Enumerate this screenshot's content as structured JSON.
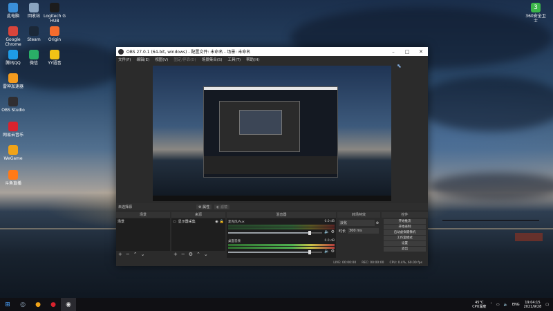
{
  "desktop": {
    "icons": [
      {
        "label": "此电脑",
        "icon": "computer-icon",
        "color": "#3a8fd9"
      },
      {
        "label": "回收站",
        "icon": "recycle-bin-icon",
        "color": "#8aa4c0"
      },
      {
        "label": "Logitech G HUB",
        "icon": "logitech-icon",
        "color": "#1c1c1c"
      },
      {
        "label": "Google Chrome",
        "icon": "chrome-icon",
        "color": "#d9453b"
      },
      {
        "label": "Steam",
        "icon": "steam-icon",
        "color": "#1b2838"
      },
      {
        "label": "Origin",
        "icon": "origin-icon",
        "color": "#f56c2d"
      },
      {
        "label": "腾讯QQ",
        "icon": "qq-icon",
        "color": "#1e9be6"
      },
      {
        "label": "微信",
        "icon": "wechat-icon",
        "color": "#2aae67"
      },
      {
        "label": "YY语音",
        "icon": "yy-icon",
        "color": "#f2c416"
      },
      {
        "label": "雷神加速器",
        "icon": "leishen-icon",
        "color": "#f39b1e"
      },
      {
        "label": "OBS Studio",
        "icon": "obs-icon",
        "color": "#302e31"
      },
      {
        "label": "网易云音乐",
        "icon": "netease-music-icon",
        "color": "#d9232e"
      },
      {
        "label": "WeGame",
        "icon": "wegame-icon",
        "color": "#f0a318"
      },
      {
        "label": "斗鱼直播",
        "icon": "douyu-icon",
        "color": "#ff7a18"
      }
    ],
    "right_icon": {
      "label": "360安全卫士",
      "icon": "360-icon",
      "color": "#3cb64a"
    }
  },
  "obs": {
    "title": "OBS 27.0.1 (64-bit, windows) - 配置文件: 未命名 - 场景: 未命名",
    "menu": [
      "文件(F)",
      "编辑(E)",
      "视图(V)",
      "固定/停靠(D)",
      "场景集合(S)",
      "工具(T)",
      "帮助(H)"
    ],
    "scene_bar": {
      "label": "未选择源",
      "properties": "属性",
      "filters": "滤镜"
    },
    "docks": {
      "scenes": {
        "header": "场景",
        "items": [
          "场景"
        ]
      },
      "sources": {
        "header": "来源",
        "items": [
          "显示器采集"
        ]
      },
      "mixer": {
        "header": "混音器",
        "channels": [
          {
            "name": "麦克风/Aux",
            "db": "0.0 dB"
          },
          {
            "name": "桌面音频",
            "db": "0.0 dB"
          }
        ]
      },
      "transitions": {
        "header": "转场特效",
        "type_label": "淡化",
        "duration_label": "时长",
        "duration_value": "300 ms"
      },
      "controls": {
        "header": "控件",
        "buttons": [
          "开始推流",
          "开始录制",
          "启动虚拟摄像机",
          "工作室模式",
          "设置",
          "退出"
        ]
      }
    },
    "status": {
      "live": "LIVE: 00:00:00",
      "rec": "REC: 00:00:00",
      "cpu": "CPU: 0.4%, 60.00 fps"
    }
  },
  "taskbar": {
    "temp": "45°C",
    "temp_label": "CPU温度",
    "lang": "ENG",
    "time": "19:04:15",
    "date": "2021/9/28"
  }
}
